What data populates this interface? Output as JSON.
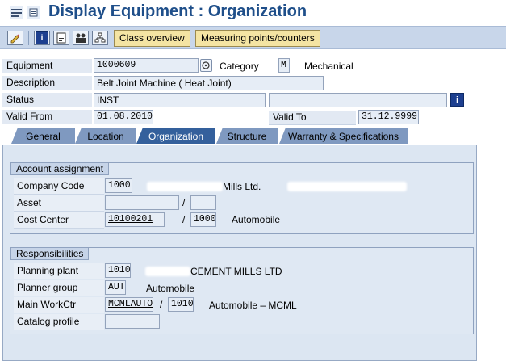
{
  "title": "Display Equipment : Organization",
  "toolbar": {
    "class_overview_label": "Class overview",
    "measuring_points_label": "Measuring points/counters"
  },
  "header": {
    "equipment_label": "Equipment",
    "equipment_value": "1000609",
    "category_label": "Category",
    "category_value": "M",
    "category_text": "Mechanical",
    "description_label": "Description",
    "description_value": "Belt Joint Machine ( Heat Joint)",
    "status_label": "Status",
    "status_value": "INST",
    "valid_from_label": "Valid From",
    "valid_from_value": "01.08.2010",
    "valid_to_label": "Valid To",
    "valid_to_value": "31.12.9999"
  },
  "tabs": [
    {
      "label": "General"
    },
    {
      "label": "Location"
    },
    {
      "label": "Organization"
    },
    {
      "label": "Structure"
    },
    {
      "label": "Warranty & Specifications"
    }
  ],
  "account_assignment": {
    "title": "Account assignment",
    "company_code_label": "Company Code",
    "company_code_value": "1000",
    "company_name_suffix": "Mills Ltd.",
    "asset_label": "Asset",
    "asset_value": "",
    "asset_sub_value": "",
    "cost_center_label": "Cost Center",
    "cost_center_value": "10100201",
    "cost_center_sub_value": "1000",
    "cost_center_text": "Automobile",
    "slash": "/"
  },
  "responsibilities": {
    "title": "Responsibilities",
    "planning_plant_label": "Planning plant",
    "planning_plant_value": "1010",
    "planning_plant_text": "CEMENT MILLS LTD",
    "planner_group_label": "Planner group",
    "planner_group_value": "AUT",
    "planner_group_text": "Automobile",
    "main_workctr_label": "Main WorkCtr",
    "main_workctr_value": "MCMLAUTO",
    "main_workctr_sub_value": "1010",
    "main_workctr_text": "Automobile – MCML",
    "catalog_profile_label": "Catalog profile",
    "catalog_profile_value": "",
    "slash": "/"
  },
  "colors": {
    "title_blue": "#1f4f8a",
    "toolbar_bg": "#c8d6ea",
    "active_tab": "#34609c",
    "inactive_tab": "#7f99c0",
    "content_bg": "#dce6f2"
  }
}
